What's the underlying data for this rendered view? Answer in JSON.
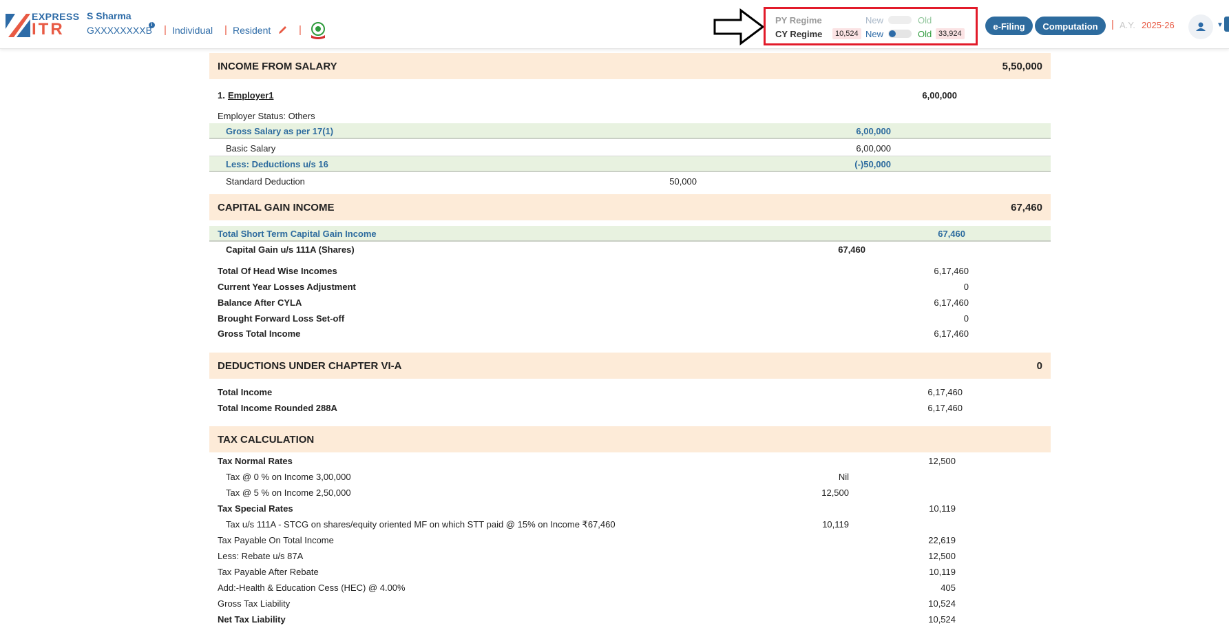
{
  "header": {
    "logo_top": "EXPRESS",
    "logo_bottom": "ITR",
    "user_name": "S Sharma",
    "pan": "GXXXXXXXXB",
    "info_symbol": "i",
    "type": "Individual",
    "residency": "Resident",
    "sep": "|",
    "regime": {
      "py_label": "PY Regime",
      "cy_label": "CY Regime",
      "new_label": "New",
      "old_label": "Old",
      "cy_new_tax": "10,524",
      "cy_old_tax": "33,924"
    },
    "efiling_label": "e-Filing",
    "computation_label": "Computation",
    "ay_label": "A.Y.",
    "ay_value": "2025-26"
  },
  "salary": {
    "title": "INCOME FROM SALARY",
    "total": "5,50,000",
    "employer_prefix": "1.",
    "employer_name": "Employer1",
    "employer_amount": "6,00,000",
    "employer_status": "Employer Status: Others",
    "gross_label": "Gross Salary as per 17(1)",
    "gross_value": "6,00,000",
    "basic_label": "Basic Salary",
    "basic_value": "6,00,000",
    "less_label": "Less: Deductions u/s 16",
    "less_value": "(-)50,000",
    "std_label": "Standard Deduction",
    "std_value": "50,000"
  },
  "capital_gain": {
    "title": "CAPITAL GAIN INCOME",
    "total": "67,460",
    "stcg_label": "Total Short Term Capital Gain Income",
    "stcg_value": "67,460",
    "cg111a_label": "Capital Gain u/s 111A (Shares)",
    "cg111a_value": "67,460"
  },
  "summary": [
    {
      "label": "Total Of Head Wise Incomes",
      "value": "6,17,460"
    },
    {
      "label": "Current Year Losses Adjustment",
      "value": "0"
    },
    {
      "label": "Balance After CYLA",
      "value": "6,17,460"
    },
    {
      "label": "Brought Forward Loss Set-off",
      "value": "0"
    },
    {
      "label": "Gross Total Income",
      "value": "6,17,460"
    }
  ],
  "deductions": {
    "title": "DEDUCTIONS UNDER CHAPTER VI-A",
    "total": "0",
    "total_income_label": "Total Income",
    "total_income_value": "6,17,460",
    "rounded_label": "Total Income Rounded 288A",
    "rounded_value": "6,17,460"
  },
  "tax": {
    "title": "TAX CALCULATION",
    "normal_label": "Tax Normal Rates",
    "normal_value": "12,500",
    "slab0_label": "Tax @ 0 % on Income 3,00,000",
    "slab0_value": "Nil",
    "slab5_label": "Tax @ 5 % on Income 2,50,000",
    "slab5_value": "12,500",
    "special_label": "Tax Special Rates",
    "special_value": "10,119",
    "stcg_tax_label": "Tax u/s 111A - STCG on shares/equity oriented MF on which STT paid @ 15% on Income ₹67,460",
    "stcg_tax_value": "10,119",
    "payable_label": "Tax Payable On Total Income",
    "payable_value": "22,619",
    "rebate_label": "Less: Rebate u/s 87A",
    "rebate_value": "12,500",
    "after_rebate_label": "Tax Payable After Rebate",
    "after_rebate_value": "10,119",
    "cess_label": "Add:-Health & Education Cess (HEC) @ 4.00%",
    "cess_value": "405",
    "gross_liab_label": "Gross Tax Liability",
    "gross_liab_value": "10,524",
    "net_liab_label": "Net Tax Liability",
    "net_liab_value": "10,524"
  },
  "colors": {
    "brand_blue": "#2d6ba7",
    "brand_red": "#e85a44",
    "section_bg": "#fdebd8",
    "subsection_bg": "#e8f2e0",
    "highlight_border": "#e21b2a"
  }
}
